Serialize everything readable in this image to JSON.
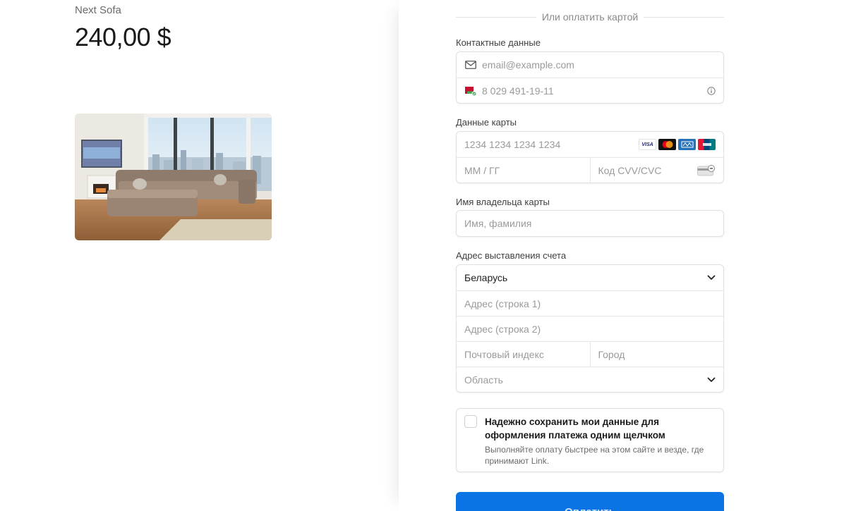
{
  "product": {
    "name": "Next Sofa",
    "price": "240,00 $",
    "image_alt": "sofa-photo"
  },
  "divider": {
    "text": "Или оплатить картой"
  },
  "contact": {
    "label": "Контактные данные",
    "email_placeholder": "email@example.com",
    "phone_placeholder": "8 029 491-19-11"
  },
  "card": {
    "label": "Данные карты",
    "number_placeholder": "1234 1234 1234 1234",
    "expiry_placeholder": "ММ / ГГ",
    "cvc_placeholder": "Код CVV/CVC",
    "brands": [
      "VISA",
      "mastercard",
      "amex",
      "unionpay"
    ]
  },
  "holder": {
    "label": "Имя владельца карты",
    "name_placeholder": "Имя, фамилия"
  },
  "billing": {
    "label": "Адрес выставления счета",
    "country": "Беларусь",
    "line1_placeholder": "Адрес (строка 1)",
    "line2_placeholder": "Адрес (строка 2)",
    "postal_placeholder": "Почтовый индекс",
    "city_placeholder": "Город",
    "region_placeholder": "Область"
  },
  "save": {
    "title": "Надежно сохранить мои данные для оформления платежа одним щелчком",
    "description": "Выполняйте оплату быстрее на этом сайте и везде, где принимают Link."
  },
  "pay": {
    "label": "Оплатить"
  },
  "colors": {
    "accent": "#0a74e4",
    "border": "#e0e0e0"
  }
}
